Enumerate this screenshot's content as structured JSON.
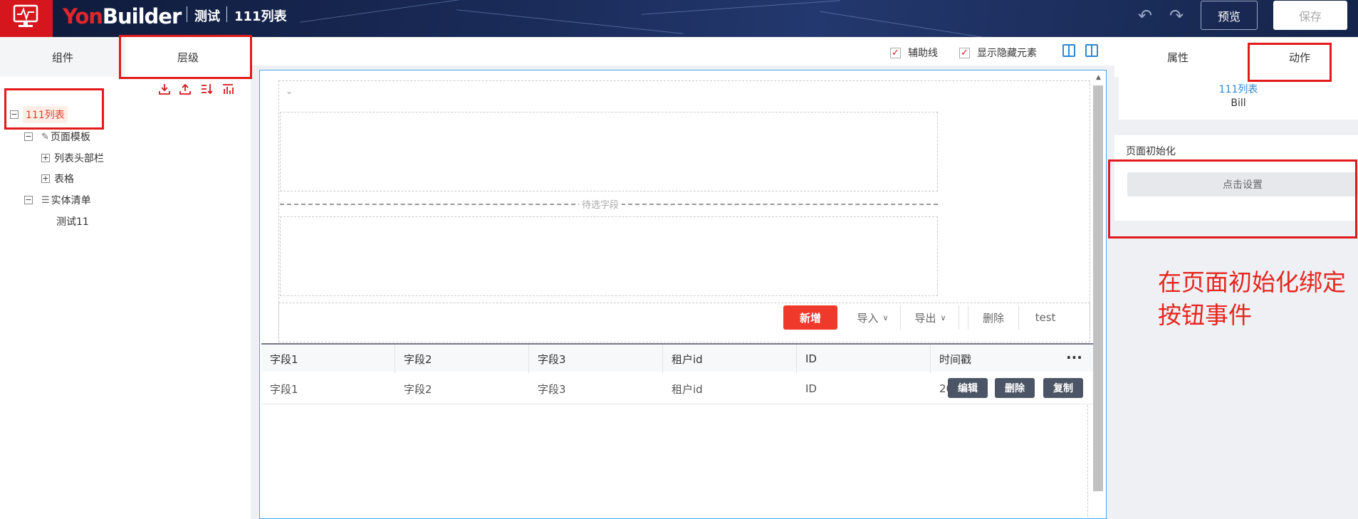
{
  "header": {
    "brand": "YonBuilder",
    "brand_prefix": "Yon",
    "brand_suffix": "Builder",
    "crumbs": [
      "测试",
      "111列表"
    ],
    "undo_icon": "undo-icon",
    "redo_icon": "redo-icon",
    "preview_label": "预览",
    "save_label": "保存"
  },
  "left_panel": {
    "tabs": [
      "组件",
      "层级"
    ],
    "active_tab": "层级",
    "tools": [
      "import-icon",
      "export-icon",
      "sort-icon",
      "chart-icon"
    ],
    "tree": [
      {
        "label": "111列表",
        "level": 0,
        "expander": "−",
        "selected": true
      },
      {
        "label": "页面模板",
        "level": 1,
        "expander": "−",
        "icon": "edit-icon"
      },
      {
        "label": "列表头部栏",
        "level": 2,
        "expander": "+"
      },
      {
        "label": "表格",
        "level": 2,
        "expander": "+"
      },
      {
        "label": "实体清单",
        "level": 1,
        "expander": "−",
        "icon": "entity-icon"
      },
      {
        "label": "测试11",
        "level": 2,
        "expander": ""
      }
    ]
  },
  "canvas_toolbar": {
    "guide_lines": {
      "label": "辅助线",
      "checked": true
    },
    "show_hidden": {
      "label": "显示隐藏元素",
      "checked": true
    }
  },
  "canvas": {
    "collapse_icon": "chevron-down-icon",
    "placeholder": "待选字段",
    "toolbar_buttons": [
      "新增",
      "导入",
      "导出",
      "删除",
      "test"
    ],
    "table": {
      "headers": [
        "字段1",
        "字段2",
        "字段3",
        "租户id",
        "ID",
        "时间戳"
      ],
      "more_icon": "more-icon",
      "row": [
        "字段1",
        "字段2",
        "字段3",
        "租户id",
        "ID",
        "20…6…3"
      ],
      "row_actions": [
        "编辑",
        "删除",
        "复制"
      ]
    }
  },
  "right_panel": {
    "tabs": [
      "属性",
      "动作"
    ],
    "active_tab": "动作",
    "entity_name": "111列表",
    "entity_type": "Bill",
    "section_title": "页面初始化",
    "set_button": "点击设置"
  },
  "annotation": [
    "在页面初始化绑定",
    "按钮事件"
  ],
  "colors": {
    "accent": "#d6161d",
    "annotation": "#e21a1a",
    "link": "#2b89d6"
  }
}
